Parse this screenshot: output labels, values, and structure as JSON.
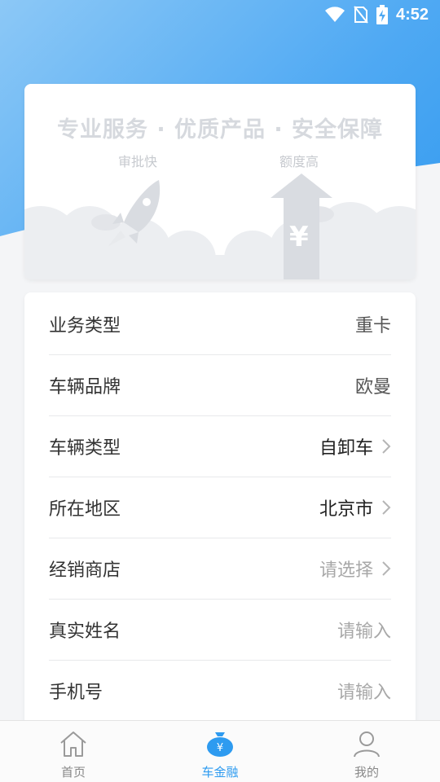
{
  "status_bar": {
    "time": "4:52",
    "icons": [
      "wifi-icon",
      "no-sim-icon",
      "battery-charging-icon"
    ]
  },
  "banner": {
    "headline": "专业服务 · 优质产品 · 安全保障",
    "tag_left": "审批快",
    "tag_right": "额度高",
    "currency_symbol": "¥"
  },
  "form": {
    "rows": [
      {
        "label": "业务类型",
        "value": "重卡",
        "kind": "static",
        "chevron": false
      },
      {
        "label": "车辆品牌",
        "value": "欧曼",
        "kind": "static",
        "chevron": false
      },
      {
        "label": "车辆类型",
        "value": "自卸车",
        "kind": "selected",
        "chevron": true
      },
      {
        "label": "所在地区",
        "value": "北京市",
        "kind": "selected",
        "chevron": true
      },
      {
        "label": "经销商店",
        "value": "请选择",
        "kind": "placeholder",
        "chevron": true
      },
      {
        "label": "真实姓名",
        "value": "请输入",
        "kind": "placeholder",
        "chevron": false
      },
      {
        "label": "手机号",
        "value": "请输入",
        "kind": "placeholder",
        "chevron": false
      }
    ]
  },
  "tab_bar": {
    "tabs": [
      {
        "label": "首页",
        "icon": "home-icon",
        "active": false
      },
      {
        "label": "车金融",
        "icon": "money-bag-icon",
        "active": true
      },
      {
        "label": "我的",
        "icon": "user-icon",
        "active": false
      }
    ]
  },
  "colors": {
    "accent": "#2e9bf0",
    "gradient_light": "#8cc8f6",
    "gradient_dark": "#2d97ef"
  }
}
